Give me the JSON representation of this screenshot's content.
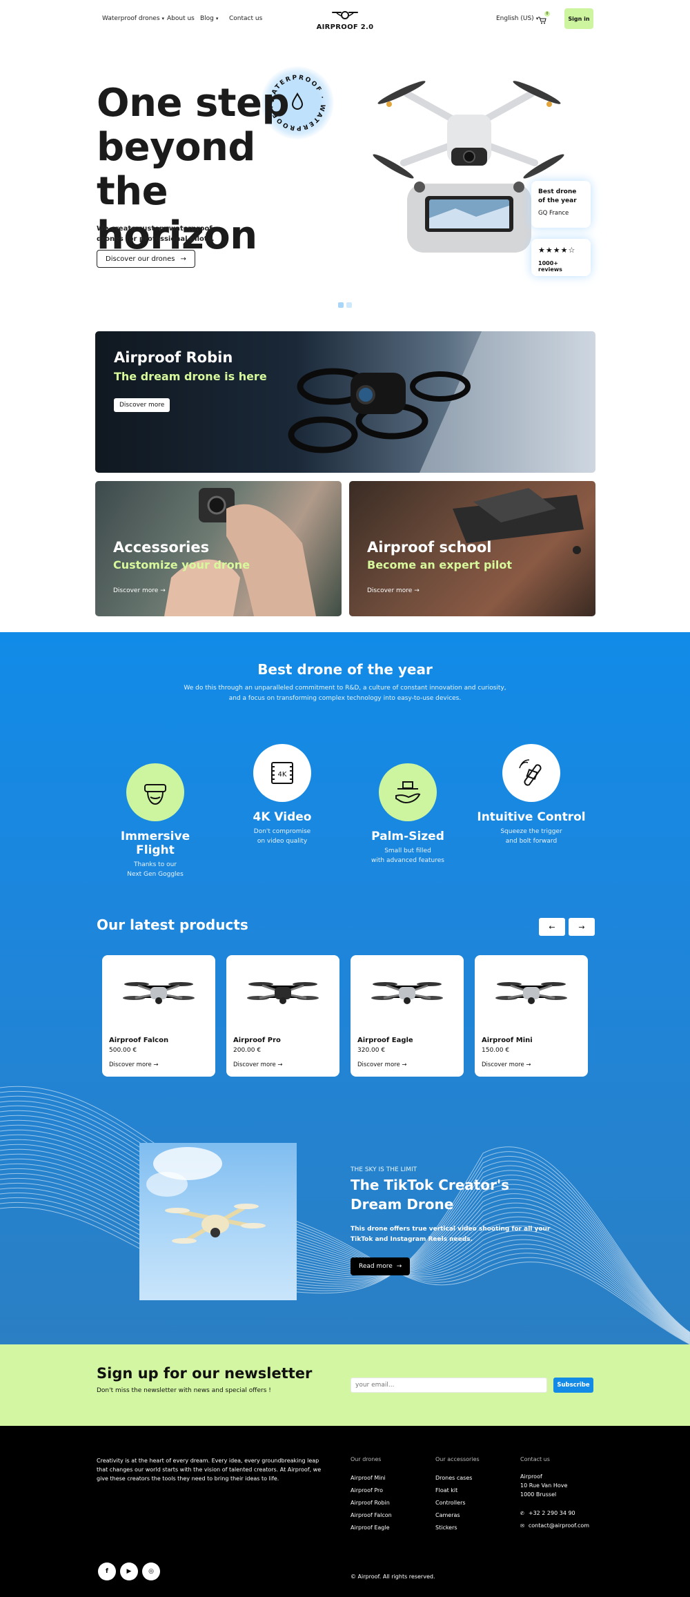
{
  "header": {
    "nav": [
      {
        "label": "Waterproof drones",
        "dropdown": true
      },
      {
        "label": "About us",
        "dropdown": false
      },
      {
        "label": "Blog",
        "dropdown": true
      },
      {
        "label": "Contact us",
        "dropdown": false
      }
    ],
    "logo_text": "AIRPROOF 2.0",
    "language": "English (US)",
    "cart_count": "0",
    "signin_label": "Sign in"
  },
  "hero": {
    "title": "One step beyond the horizon",
    "subtitle": "We create custom waterproof drones for professional pilots.",
    "cta_label": "Discover our drones",
    "seal_text": "WATERPROOF · WATERPROOF ·",
    "award_card": {
      "title": "Best drone of the year",
      "source": "GQ France"
    },
    "rating_card": {
      "stars": 4,
      "max": 5,
      "reviews": "1000+ reviews"
    },
    "slides": 2,
    "active_slide": 1
  },
  "tiles": {
    "robin": {
      "title": "Airproof Robin",
      "subtitle": "The dream drone is here",
      "cta": "Discover more"
    },
    "accessories": {
      "title": "Accessories",
      "subtitle": "Customize your drone",
      "cta": "Discover more"
    },
    "school": {
      "title": "Airproof school",
      "subtitle": "Become an expert pilot",
      "cta": "Discover more"
    }
  },
  "features": {
    "title": "Best drone of the year",
    "description": "We do this through an unparalleled commitment to R&D, a culture of constant innovation and curiosity, and a focus on transforming complex technology into easy-to-use devices.",
    "items": [
      {
        "title": "Immersive Flight",
        "text1": "Thanks to our",
        "text2": "Next Gen Goggles",
        "icon": "goggles-icon"
      },
      {
        "title": "4K Video",
        "text1": "Don't compromise",
        "text2": "on video quality",
        "icon": "film-4k-icon"
      },
      {
        "title": "Palm-Sized",
        "text1": "Small but filled",
        "text2": "with advanced features",
        "icon": "hand-drone-icon"
      },
      {
        "title": "Intuitive Control",
        "text1": "Squeeze the trigger",
        "text2": "and bolt forward",
        "icon": "joystick-icon"
      }
    ]
  },
  "products": {
    "title": "Our latest products",
    "prev_icon": "←",
    "next_icon": "→",
    "items": [
      {
        "name": "Airproof Falcon",
        "price": "500.00 €",
        "cta": "Discover more"
      },
      {
        "name": "Airproof Pro",
        "price": "200.00 €",
        "cta": "Discover more"
      },
      {
        "name": "Airproof Eagle",
        "price": "320.00 €",
        "cta": "Discover more"
      },
      {
        "name": "Airproof Mini",
        "price": "150.00 €",
        "cta": "Discover more"
      }
    ]
  },
  "promo": {
    "eyebrow": "THE SKY IS THE LIMIT",
    "title": "The TikTok Creator's Dream Drone",
    "text": "This drone offers true vertical video shooting for all your TikTok and Instagram Reels needs.",
    "cta": "Read more"
  },
  "newsletter": {
    "title": "Sign up for our newsletter",
    "text": "Don't miss the newsletter with news and special offers !",
    "placeholder": "your email...",
    "button": "Subscribe"
  },
  "footer": {
    "about": "Creativity is at the heart of every dream. Every idea, every groundbreaking leap that changes our world starts with the vision of talented creators. At Airproof, we give these creators the tools they need to bring their ideas to life.",
    "col1": {
      "title": "Our drones",
      "links": [
        "Airproof Mini",
        "Airproof Pro",
        "Airproof Robin",
        "Airproof Falcon",
        "Airproof Eagle"
      ]
    },
    "col2": {
      "title": "Our accessories",
      "links": [
        "Drones cases",
        "Float kit",
        "Controllers",
        "Cameras",
        "Stickers"
      ]
    },
    "col3": {
      "title": "Contact us",
      "address": [
        "Airproof",
        "10 Rue Van Hove",
        "1000 Brussel"
      ],
      "phone": "+32 2 290 34 90",
      "email": "contact@airproof.com"
    },
    "social": [
      "facebook-icon",
      "youtube-icon",
      "instagram-icon"
    ],
    "copyright": "© Airproof. All rights reserved."
  },
  "colors": {
    "accent_green": "#cdf59f",
    "brand_blue": "#118be8",
    "dark": "#111111"
  }
}
